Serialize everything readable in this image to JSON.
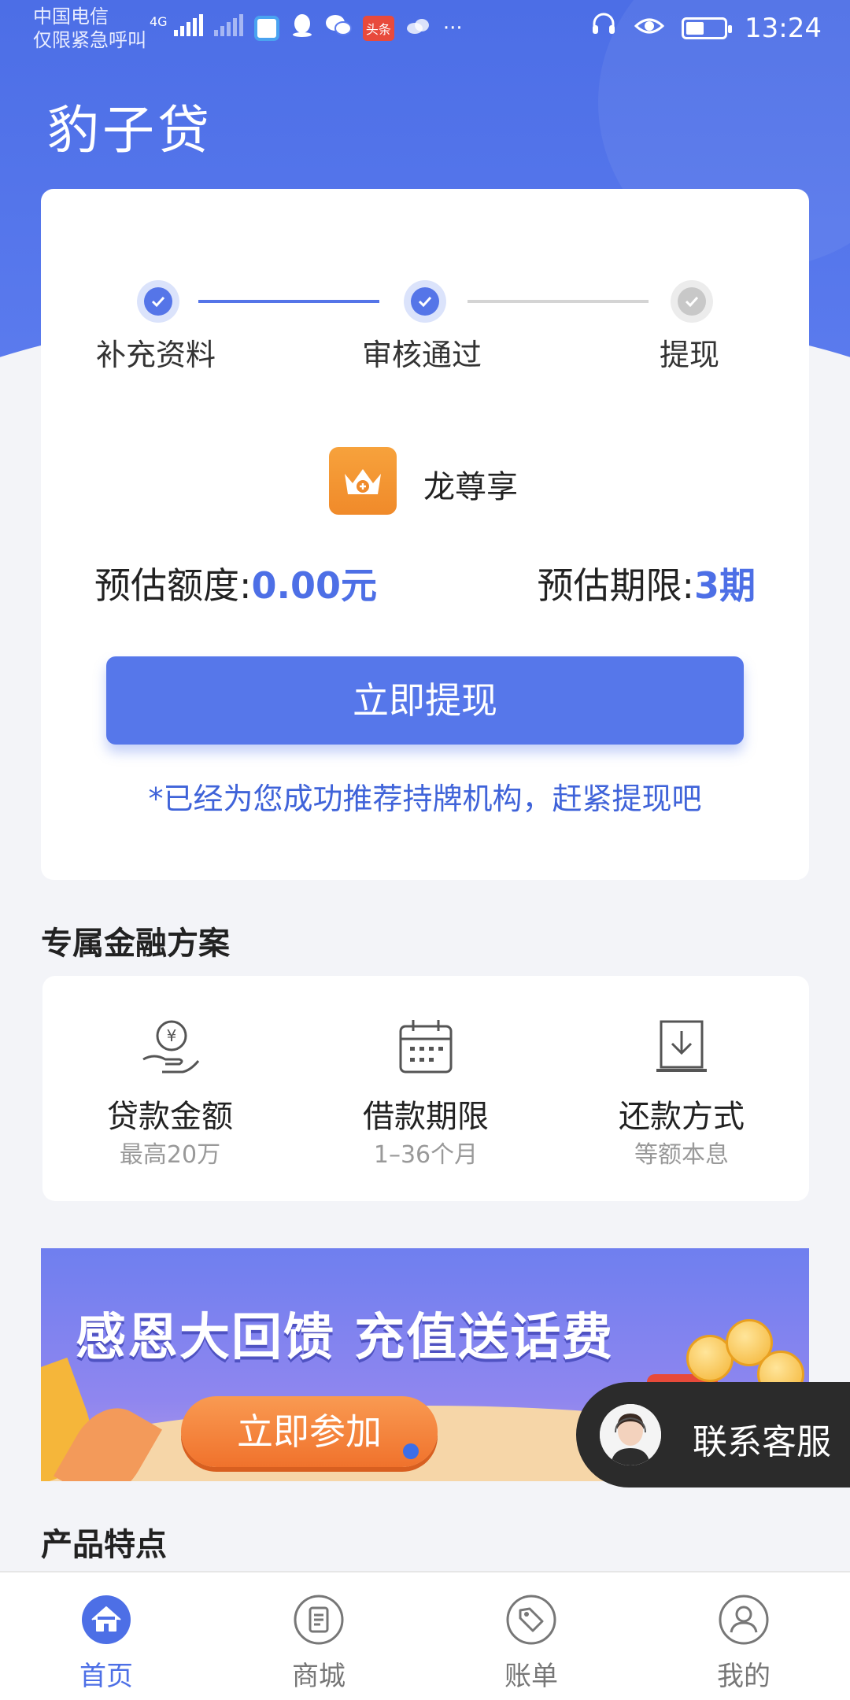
{
  "status_bar": {
    "carrier_line1": "中国电信",
    "carrier_line2": "仅限紧急呼叫",
    "network": "4G",
    "time": "13:24",
    "news_badge": "头条",
    "more": "···"
  },
  "app": {
    "title": "豹子贷"
  },
  "progress": {
    "steps": [
      {
        "label": "补充资料",
        "done": true
      },
      {
        "label": "审核通过",
        "done": true
      },
      {
        "label": "提现",
        "done": false
      }
    ]
  },
  "brand": {
    "name": "龙尊享",
    "icon": "crown-icon"
  },
  "estimate": {
    "amount_label": "预估额度:",
    "amount_value": "0.00元",
    "term_label": "预估期限:",
    "term_value": "3期"
  },
  "withdraw_button": "立即提现",
  "notice": "*已经为您成功推荐持牌机构，赶紧提现吧",
  "finance_section": {
    "title": "专属金融方案",
    "items": [
      {
        "name": "贷款金额",
        "sub": "最高20万",
        "icon": "money-hand-icon"
      },
      {
        "name": "借款期限",
        "sub": "1–36个月",
        "icon": "calendar-icon"
      },
      {
        "name": "还款方式",
        "sub": "等额本息",
        "icon": "download-tray-icon"
      }
    ]
  },
  "banner": {
    "title": "感恩大回馈 充值送话费",
    "button": "立即参加"
  },
  "contact": {
    "label": "联系客服",
    "icon": "customer-service-avatar"
  },
  "features_section": {
    "title": "产品特点"
  },
  "bottom_nav": {
    "items": [
      {
        "label": "首页",
        "icon": "home-icon",
        "active": true
      },
      {
        "label": "商城",
        "icon": "shop-list-icon",
        "active": false
      },
      {
        "label": "账单",
        "icon": "tag-icon",
        "active": false
      },
      {
        "label": "我的",
        "icon": "profile-icon",
        "active": false
      }
    ]
  },
  "colors": {
    "primary": "#5677ea",
    "header": "#4c6ee6",
    "accent_text": "#4d6fe6",
    "inactive": "#c8c8c8"
  }
}
